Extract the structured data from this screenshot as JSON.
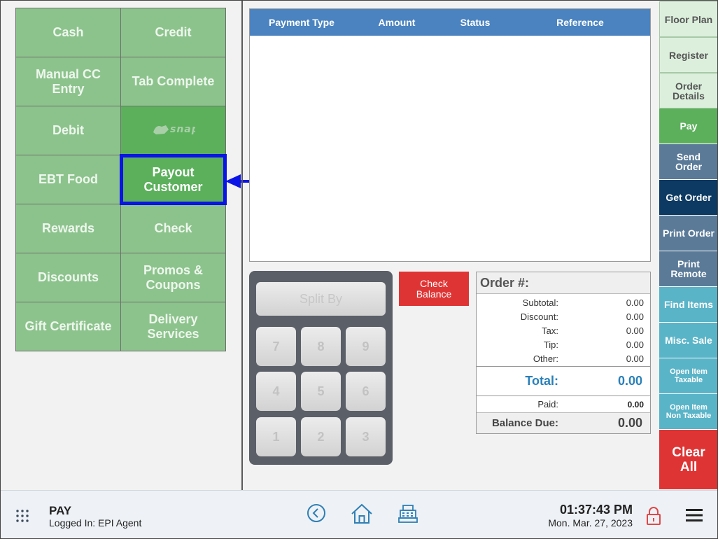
{
  "payment_methods": [
    {
      "label": "Cash"
    },
    {
      "label": "Credit"
    },
    {
      "label": "Manual CC Entry"
    },
    {
      "label": "Tab Complete"
    },
    {
      "label": "Debit"
    },
    {
      "label": "Snap logo",
      "icon": "ebt-snap-logo"
    },
    {
      "label": "EBT Food"
    },
    {
      "label": "Payout Customer"
    },
    {
      "label": "Rewards"
    },
    {
      "label": "Check"
    },
    {
      "label": "Discounts"
    },
    {
      "label": "Promos & Coupons"
    },
    {
      "label": "Gift Certificate"
    },
    {
      "label": "Delivery Services"
    }
  ],
  "payments_table": {
    "headers": [
      "Payment Type",
      "Amount",
      "Status",
      "Reference"
    ]
  },
  "numpad": {
    "split_by": "Split By",
    "keys": [
      "7",
      "8",
      "9",
      "4",
      "5",
      "6",
      "1",
      "2",
      "3"
    ]
  },
  "check_balance": "Check Balance",
  "order_summary": {
    "title": "Order #:",
    "rows": [
      {
        "label": "Subtotal:",
        "value": "0.00"
      },
      {
        "label": "Discount:",
        "value": "0.00"
      },
      {
        "label": "Tax:",
        "value": "0.00"
      },
      {
        "label": "Tip:",
        "value": "0.00"
      },
      {
        "label": "Other:",
        "value": "0.00"
      }
    ],
    "total_label": "Total:",
    "total_value": "0.00",
    "paid_label": "Paid:",
    "paid_value": "0.00",
    "balance_label": "Balance Due:",
    "balance_value": "0.00"
  },
  "right_nav": [
    {
      "label": "Floor Plan"
    },
    {
      "label": "Register"
    },
    {
      "label": "Order Details"
    },
    {
      "label": "Pay"
    },
    {
      "label": "Send Order"
    },
    {
      "label": "Get Order"
    },
    {
      "label": "Print Order"
    },
    {
      "label": "Print Remote"
    },
    {
      "label": "Find Items"
    },
    {
      "label": "Misc. Sale"
    },
    {
      "label": "Open Item Taxable"
    },
    {
      "label": "Open Item Non Taxable"
    },
    {
      "label": "Clear All"
    }
  ],
  "footer": {
    "title": "PAY",
    "logged_in": "Logged In:  EPI Agent",
    "time": "01:37:43 PM",
    "date": "Mon. Mar. 27, 2023",
    "icons": [
      "apps-grid-icon",
      "back-icon",
      "home-icon",
      "cash-register-icon",
      "lock-icon",
      "menu-icon"
    ]
  },
  "colors": {
    "pay_button": "#8cc38c",
    "pay_button_active": "#5cb05c",
    "selection_outline": "#0a14e6",
    "table_header": "#4a83c0",
    "danger": "#df3434",
    "total_text": "#2980b9"
  }
}
